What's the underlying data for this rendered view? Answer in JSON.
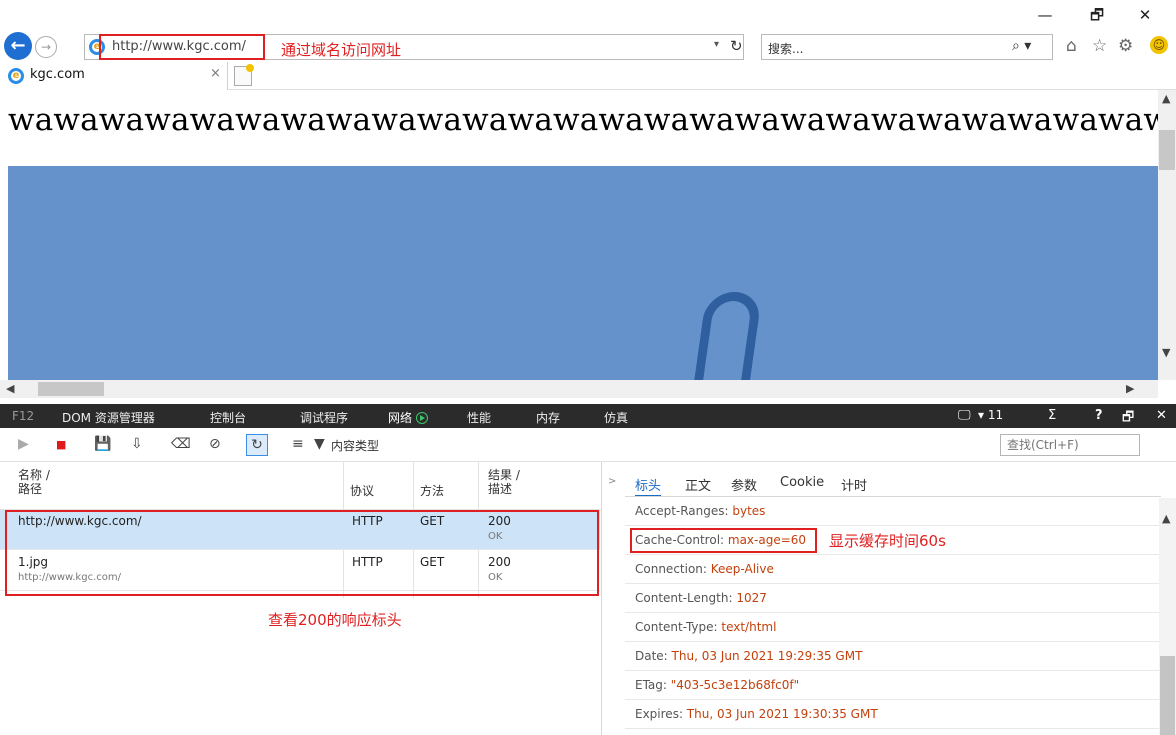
{
  "window": {
    "minimize": "—",
    "restore": "🗗",
    "close": "✕"
  },
  "address_bar": {
    "url": "http://www.kgc.com/",
    "annotation": "通过域名访问网址",
    "dropdown": "▾",
    "refresh": "↻"
  },
  "search": {
    "placeholder": "搜索...",
    "icon": "⌕ ▾"
  },
  "toolbar_icons": {
    "home": "⌂",
    "favorites": "☆",
    "settings": "⚙",
    "feedback": "☺"
  },
  "tab": {
    "title": "kgc.com",
    "close": "×"
  },
  "page": {
    "heading": "wawawawawawawawawawawawawawawawawawawawawawawawawawawawawawa"
  },
  "devtools": {
    "tabs": [
      "F12",
      "DOM 资源管理器",
      "控制台",
      "调试程序",
      "网络",
      "性能",
      "内存",
      "仿真"
    ],
    "error_count": "▾ 11",
    "help": "?",
    "undock": "🗗",
    "close": "✕",
    "content_type_filter": "内容类型",
    "find_placeholder": "查找(Ctrl+F)"
  },
  "request_list": {
    "columns": {
      "name": "名称 /",
      "path": "路径",
      "protocol": "协议",
      "method": "方法",
      "result": "结果 /",
      "description": "描述"
    },
    "rows": [
      {
        "name": "http://www.kgc.com/",
        "path": "",
        "protocol": "HTTP",
        "method": "GET",
        "result": "200",
        "description": "OK"
      },
      {
        "name": "1.jpg",
        "path": "http://www.kgc.com/",
        "protocol": "HTTP",
        "method": "GET",
        "result": "200",
        "description": "OK"
      }
    ],
    "annotation": "查看200的响应标头"
  },
  "detail_panel": {
    "tabs": [
      "标头",
      "正文",
      "参数",
      "Cookie",
      "计时"
    ],
    "headers": [
      {
        "name": "Accept-Ranges: ",
        "value": "bytes"
      },
      {
        "name": "Cache-Control: ",
        "value": "max-age=60"
      },
      {
        "name": "Connection: ",
        "value": "Keep-Alive"
      },
      {
        "name": "Content-Length: ",
        "value": "1027"
      },
      {
        "name": "Content-Type: ",
        "value": "text/html"
      },
      {
        "name": "Date: ",
        "value": "Thu, 03 Jun 2021 19:29:35 GMT"
      },
      {
        "name": "ETag: ",
        "value": "\"403-5c3e12b68fc0f\""
      },
      {
        "name": "Expires: ",
        "value": "Thu, 03 Jun 2021 19:30:35 GMT"
      }
    ],
    "annotation": "显示缓存时间60s"
  },
  "colors": {
    "annotation_red": "#e02020",
    "header_value": "#c2410c",
    "selected_row": "#cde3f7",
    "devtools_bar": "#2b2b2b",
    "page_image": "#6692cc"
  }
}
